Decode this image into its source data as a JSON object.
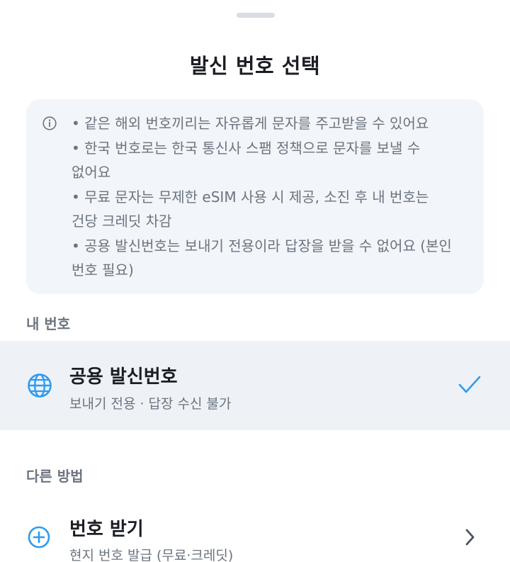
{
  "sheet": {
    "title": "발신 번호 선택"
  },
  "notice": {
    "icon": "info-icon",
    "lines": [
      "• 같은 해외 번호끼리는 자유롭게 문자를 주고받을 수 있어요",
      "• 한국 번호로는 한국 통신사 스팸 정책으로 문자를 보낼 수",
      "없어요",
      "• 무료 문자는 무제한 eSIM 사용 시 제공, 소진 후 내 번호는",
      "건당 크레딧 차감",
      "• 공용 발신번호는 보내기 전용이라 답장을 받을 수 없어요 (본인",
      "번호 필요)"
    ]
  },
  "my_numbers": {
    "label": "내 번호",
    "items": [
      {
        "icon": "globe-icon",
        "title": "공용 발신번호",
        "subtitle": "보내기 전용 · 답장 수신 불가",
        "selected": true,
        "trailing_icon": "check-icon"
      }
    ]
  },
  "other_methods": {
    "label": "다른 방법",
    "items": [
      {
        "icon": "plus-circle-icon",
        "title": "번호 받기",
        "subtitle": "현지 번호 발급 (무료·크레딧)",
        "trailing_icon": "chevron-right-icon"
      }
    ]
  },
  "colors": {
    "accent": "#2f9bf0",
    "title_text": "#1b1e24",
    "secondary_text": "#6b7480",
    "notice_bg": "#f2f5f9",
    "selected_row_bg": "#eef2f7"
  }
}
